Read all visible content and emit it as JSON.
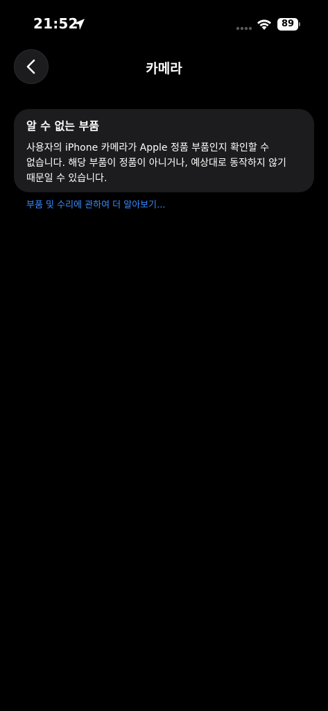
{
  "status_bar": {
    "time": "21:52",
    "battery_level": "89",
    "icons": [
      "location-arrow-icon",
      "cellular-signal-icon",
      "wifi-icon",
      "battery-icon"
    ]
  },
  "nav": {
    "title": "카메라",
    "back_icon": "chevron-left-icon"
  },
  "card": {
    "title": "알 수 없는 부품",
    "body_line1": "사용자의 iPhone 카메라가 Apple 정품 부품인지 확인할 수",
    "body_line2": "없습니다. 해당 부품이 정품이 아니거나, 예상대로 동작하지 않기",
    "body_line3": "때문일 수 있습니다."
  },
  "link": {
    "label": "부품 및 수리에 관하여 더 알아보기..."
  },
  "colors": {
    "background": "#000000",
    "card_background": "#1c1c1e",
    "link": "#3a8bff",
    "text": "#ffffff"
  }
}
